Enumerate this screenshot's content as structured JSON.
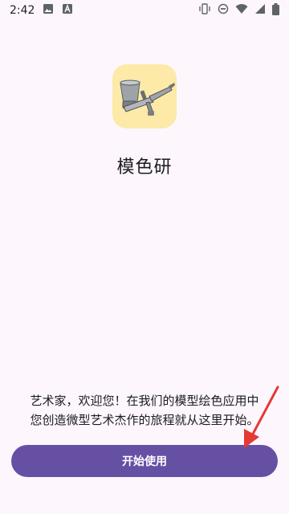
{
  "status_bar": {
    "time": "2:42",
    "left_icons": [
      "image-icon",
      "font-a-icon"
    ],
    "right_icons": [
      "vibrate-icon",
      "dnd-icon",
      "wifi-icon",
      "signal-icon",
      "battery-icon"
    ]
  },
  "app": {
    "icon": "airbrush-icon",
    "name": "模色研"
  },
  "welcome": {
    "line1": "艺术家，欢迎您！在我们的模型绘色应用中",
    "line2": "您创造微型艺术杰作的旅程就从这里开始。"
  },
  "actions": {
    "start_label": "开始使用"
  },
  "annotation": {
    "arrow_color": "#e53935"
  },
  "colors": {
    "background": "#fdf7fd",
    "primary": "#6650a4",
    "icon_bg": "#fde9a8"
  }
}
